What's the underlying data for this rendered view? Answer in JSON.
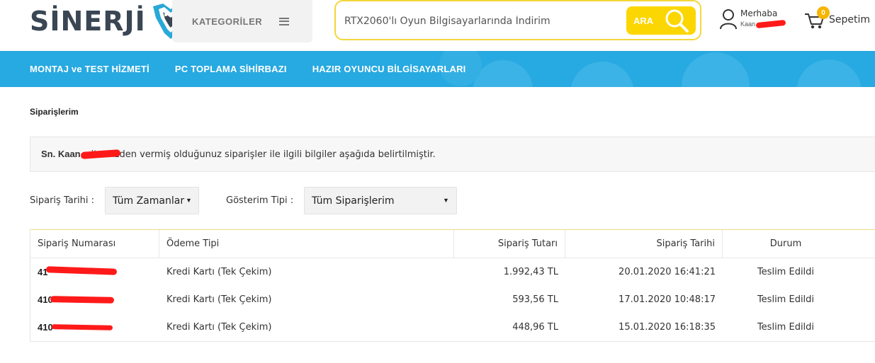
{
  "header": {
    "logo_text": "SİNERJİ",
    "categories_label": "KATEGORİLER",
    "search": {
      "value": "RTX2060'lı Oyun Bilgisayarlarında İndirim",
      "button_label": "ARA"
    },
    "account": {
      "greeting": "Merhaba",
      "name": "Kaan"
    },
    "cart": {
      "count": "0",
      "label": "Sepetim"
    }
  },
  "nav": {
    "items": [
      {
        "label": "MONTAJ ve TEST HİZMETİ"
      },
      {
        "label": "PC TOPLAMA SİHİRBAZI"
      },
      {
        "label": "HAZIR OYUNCU BİLGİSAYARLARI"
      }
    ]
  },
  "page": {
    "title": "Siparişlerim",
    "info_name": "Sn. Kaan",
    "info_text": ", sitemizden vermiş olduğunuz siparişler ile ilgili bilgiler aşağıda belirtilmiştir."
  },
  "filters": {
    "date_label": "Sipariş Tarihi :",
    "date_value": "Tüm Zamanlar",
    "type_label": "Gösterim Tipi :",
    "type_value": "Tüm Siparişlerim"
  },
  "table": {
    "headers": {
      "order_no": "Sipariş Numarası",
      "payment": "Ödeme Tipi",
      "amount": "Sipariş Tutarı",
      "date": "Sipariş Tarihi",
      "status": "Durum"
    },
    "rows": [
      {
        "order_no": "41",
        "payment": "Kredi Kartı (Tek Çekim)",
        "amount": "1.992,43 TL",
        "date": "20.01.2020 16:41:21",
        "status": "Teslim Edildi"
      },
      {
        "order_no": "410",
        "payment": "Kredi Kartı (Tek Çekim)",
        "amount": "593,56 TL",
        "date": "17.01.2020 10:48:17",
        "status": "Teslim Edildi"
      },
      {
        "order_no": "410",
        "payment": "Kredi Kartı (Tek Çekim)",
        "amount": "448,96 TL",
        "date": "15.01.2020 16:18:35",
        "status": "Teslim Edildi"
      }
    ]
  },
  "colors": {
    "nav_blue": "#27a9e1",
    "search_yellow": "#fcd600",
    "logo_dark": "#3a4654",
    "logo_teal": "#2aa8d8",
    "redaction": "#ff1a1a"
  }
}
